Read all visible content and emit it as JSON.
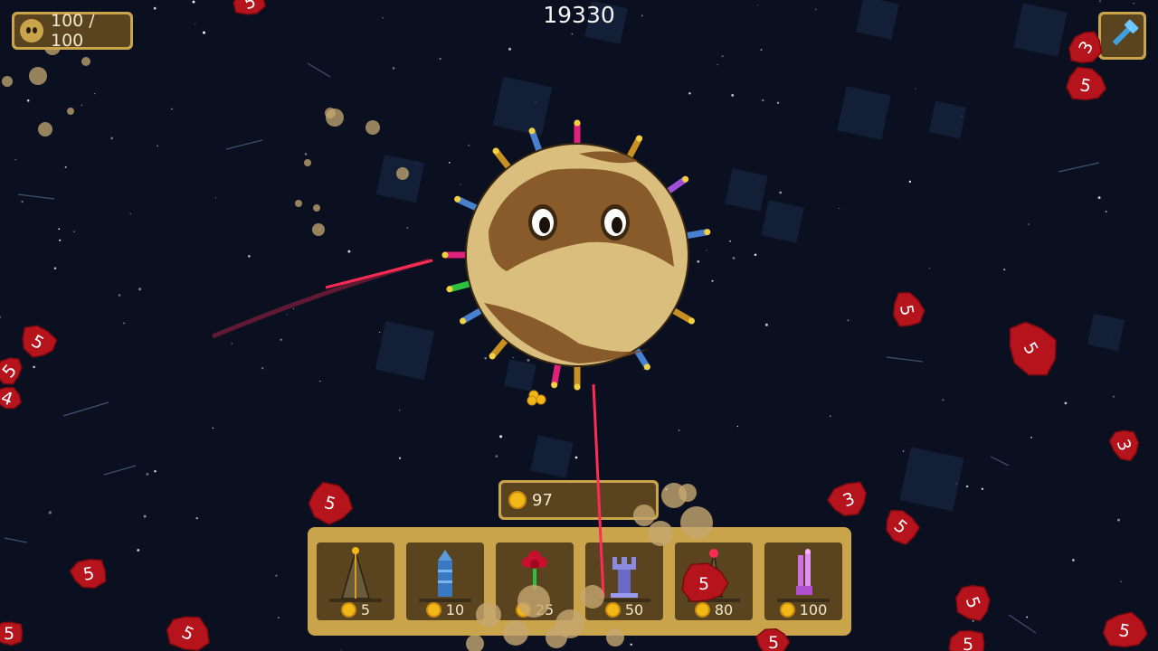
{
  "hud": {
    "health_text": "100 / 100",
    "health_current": 100,
    "health_max": 100,
    "score": "19330",
    "coins": "97",
    "build_icon": "hammer-icon"
  },
  "shop": {
    "items": [
      {
        "name": "spike-tower",
        "icon": "spike-tower-icon",
        "price": "5"
      },
      {
        "name": "blue-rocket-tower",
        "icon": "rocket-tower-icon",
        "price": "10"
      },
      {
        "name": "flower-tower",
        "icon": "flower-tower-icon",
        "price": "25"
      },
      {
        "name": "castle-tower",
        "icon": "castle-tower-icon",
        "price": "50"
      },
      {
        "name": "red-laser-tower",
        "icon": "laser-tower-icon",
        "price": "80"
      },
      {
        "name": "purple-crystal-tower",
        "icon": "crystal-tower-icon",
        "price": "100"
      }
    ]
  },
  "asteroids": [
    {
      "hp": "5"
    },
    {
      "hp": "5"
    },
    {
      "hp": "5"
    },
    {
      "hp": "4"
    },
    {
      "hp": "5"
    },
    {
      "hp": "5"
    },
    {
      "hp": "5"
    },
    {
      "hp": "5"
    },
    {
      "hp": "3"
    },
    {
      "hp": "5"
    },
    {
      "hp": "5"
    },
    {
      "hp": "3"
    },
    {
      "hp": "3"
    },
    {
      "hp": "5"
    },
    {
      "hp": "5"
    },
    {
      "hp": "5"
    },
    {
      "hp": "5"
    },
    {
      "hp": "5"
    },
    {
      "hp": "5"
    },
    {
      "hp": "5"
    }
  ],
  "colors": {
    "frame": "#c9a44a",
    "panel": "#5a4420",
    "space": "#0a1020",
    "asteroid": "#b5141c",
    "planet": "#d9be7e",
    "planet_land": "#7a4a1c",
    "laser": "#ff2a55",
    "coin": "#f2b817"
  }
}
